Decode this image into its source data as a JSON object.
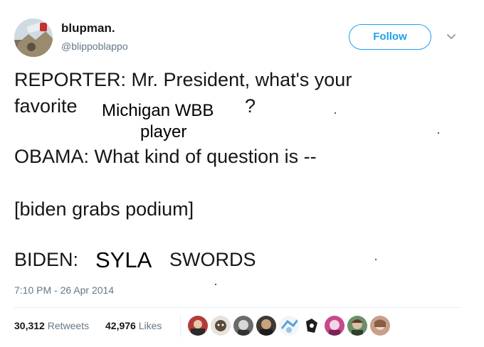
{
  "author": {
    "display_name": "blupman.",
    "handle": "@blippoblappo",
    "avatar_icon": "user-avatar-photo"
  },
  "header": {
    "follow_label": "Follow",
    "menu_icon": "chevron-down-icon"
  },
  "tweet": {
    "line1": "REPORTER: Mr. President, what's your",
    "line2": "favorite",
    "line2_end": "?",
    "line3": "OBAMA: What kind of question is --",
    "line4": "[biden grabs podium]",
    "line5_start": "BIDEN:",
    "line5_end": "SWORDS"
  },
  "overlays": {
    "michigan": "Michigan WBB",
    "player": "player",
    "syla": "SYLA"
  },
  "meta": {
    "timestamp": "7:10 PM - 26 Apr 2014"
  },
  "stats": {
    "retweets_count": "30,312",
    "retweets_label": "Retweets",
    "likes_count": "42,976",
    "likes_label": "Likes"
  },
  "colors": {
    "accent": "#1da1f2",
    "secondary_text": "#657786",
    "primary_text": "#14171a",
    "divider": "#e6ecf0"
  }
}
